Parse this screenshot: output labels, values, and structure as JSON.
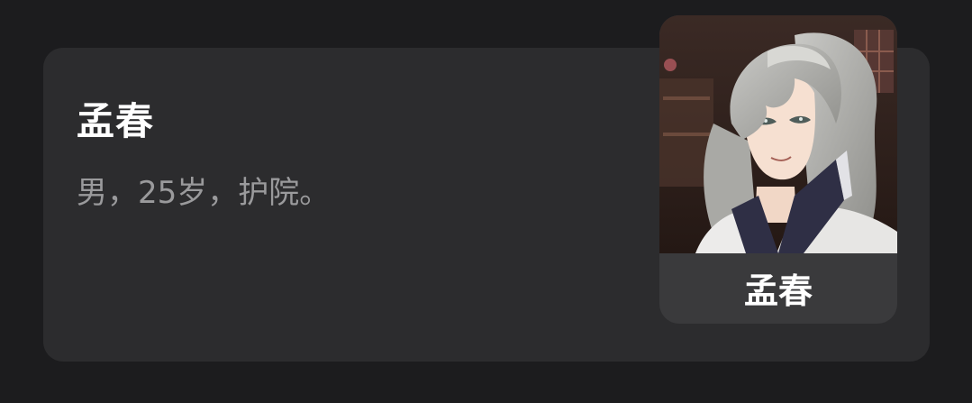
{
  "character": {
    "name": "孟春",
    "description": "男，25岁，护院。"
  },
  "portrait": {
    "caption": "孟春",
    "icon": "character-portrait"
  },
  "colors": {
    "background": "#1c1c1e",
    "card": "#2c2c2e",
    "portrait_panel": "#3a3a3c",
    "name_text": "#ffffff",
    "description_text": "#9a9a9c"
  }
}
